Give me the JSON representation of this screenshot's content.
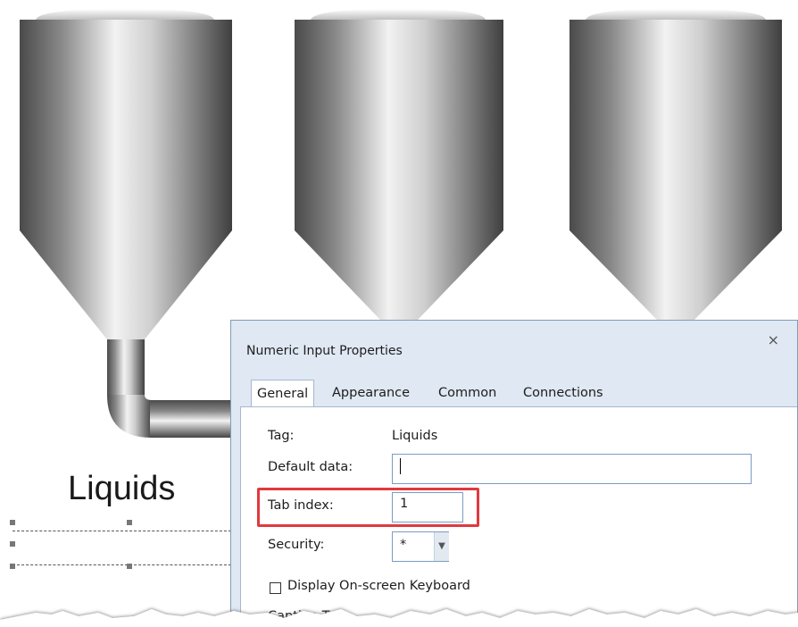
{
  "scene": {
    "caption": "Liquids"
  },
  "dialog": {
    "title": "Numeric Input Properties",
    "close_glyph": "×",
    "tabs": [
      {
        "label": "General",
        "active": true
      },
      {
        "label": "Appearance",
        "active": false
      },
      {
        "label": "Common",
        "active": false
      },
      {
        "label": "Connections",
        "active": false
      }
    ],
    "fields": {
      "tag_label": "Tag:",
      "tag_value": "Liquids",
      "default_data_label": "Default data:",
      "default_data_value": "",
      "tab_index_label": "Tab index:",
      "tab_index_value": "1",
      "security_label": "Security:",
      "security_value": "*",
      "keyboard_label": "Display On-screen Keyboard",
      "keyboard_checked": false,
      "caption_text_label": "Caption Te"
    }
  },
  "colors": {
    "highlight": "#e0393e",
    "dialog_bg": "#dfe8f3",
    "input_border": "#7a9cc6"
  }
}
